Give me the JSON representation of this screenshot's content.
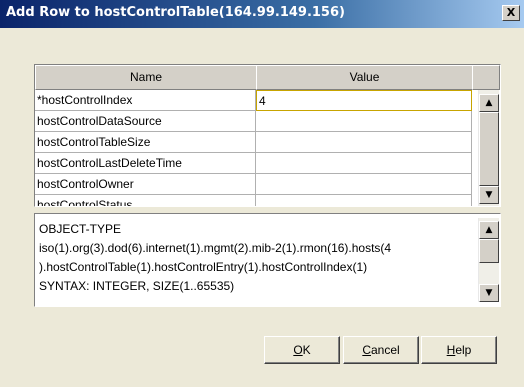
{
  "dialog": {
    "title": "Add Row to hostControlTable(164.99.149.156)",
    "close_label": "X"
  },
  "table": {
    "columns": [
      "Name",
      "Value"
    ],
    "rows": [
      {
        "name": "*hostControlIndex",
        "value": "4"
      },
      {
        "name": "hostControlDataSource",
        "value": ""
      },
      {
        "name": "hostControlTableSize",
        "value": ""
      },
      {
        "name": "hostControlLastDeleteTime",
        "value": ""
      },
      {
        "name": "hostControlOwner",
        "value": ""
      },
      {
        "name": "hostControlStatus",
        "value": ""
      }
    ]
  },
  "description": {
    "lines": [
      "OBJECT-TYPE",
      "iso(1).org(3).dod(6).internet(1).mgmt(2).mib-2(1).rmon(16).hosts(4",
      ").hostControlTable(1).hostControlEntry(1).hostControlIndex(1)",
      "SYNTAX: INTEGER, SIZE(1..65535)"
    ]
  },
  "buttons": {
    "ok": {
      "mnemonic": "O",
      "rest": "K"
    },
    "cancel": {
      "mnemonic": "C",
      "rest": "ancel"
    },
    "help": {
      "mnemonic": "H",
      "rest": "elp"
    }
  },
  "icons": {
    "scroll_up": "arrow-up-icon",
    "scroll_down": "arrow-down-icon",
    "close": "close-icon"
  },
  "colors": {
    "title_bar": "#0a246a",
    "dialog_bg": "#ece9d8",
    "edit_border": "#c7a400"
  }
}
